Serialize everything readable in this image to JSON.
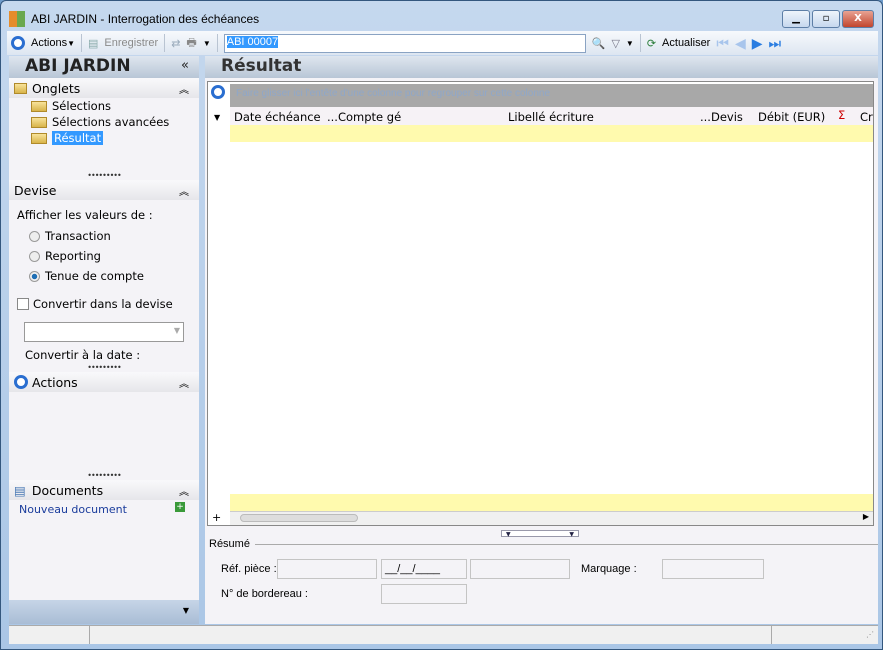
{
  "window": {
    "app": "ABI JARDIN",
    "separator": "-",
    "title": "Interrogation des échéances"
  },
  "toolbar": {
    "actions": "Actions",
    "save": "Enregistrer",
    "search_value": "ABI 00007",
    "refresh": "Actualiser"
  },
  "sidebar": {
    "title": "ABI JARDIN",
    "collapse": "«",
    "onglets": {
      "label": "Onglets",
      "items": [
        "Sélections",
        "Sélections avancées",
        "Résultat"
      ]
    },
    "devise": {
      "label": "Devise",
      "prompt": "Afficher les valeurs de :",
      "options": [
        "Transaction",
        "Reporting",
        "Tenue de compte"
      ],
      "selected": 2,
      "convert_label": "Convertir dans la devise",
      "convert_date": "Convertir à la date :"
    },
    "actions": {
      "label": "Actions"
    },
    "documents": {
      "label": "Documents",
      "new_doc": "Nouveau document"
    }
  },
  "main": {
    "title": "Résultat",
    "group_hint": "Faire glisser ici l'entête d'une colonne pour regrouper sur cette colonne",
    "columns": [
      "Date échéance",
      "...Compte gé",
      "Libellé écriture",
      "...Devis",
      "Débit (EUR)",
      "Σ",
      "Cr"
    ]
  },
  "summary": {
    "legend": "Résumé",
    "ref_piece": "Réf. pièce :",
    "date_mask": "__/__/____",
    "marquage": "Marquage :",
    "bordereau": "N° de bordereau :"
  }
}
